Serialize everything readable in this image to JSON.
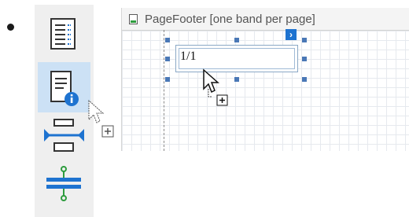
{
  "toolbox": {
    "items": [
      {
        "name": "report-icon-tool"
      },
      {
        "name": "page-info-tool",
        "selected": true
      },
      {
        "name": "page-break-tool"
      },
      {
        "name": "cross-band-line-tool"
      }
    ]
  },
  "designer": {
    "band_title": "PageFooter [one band per page]",
    "field_text": "1/1"
  },
  "colors": {
    "accent": "#1e73d0",
    "selection": "#cce1f5",
    "handle": "#4a78b6"
  }
}
